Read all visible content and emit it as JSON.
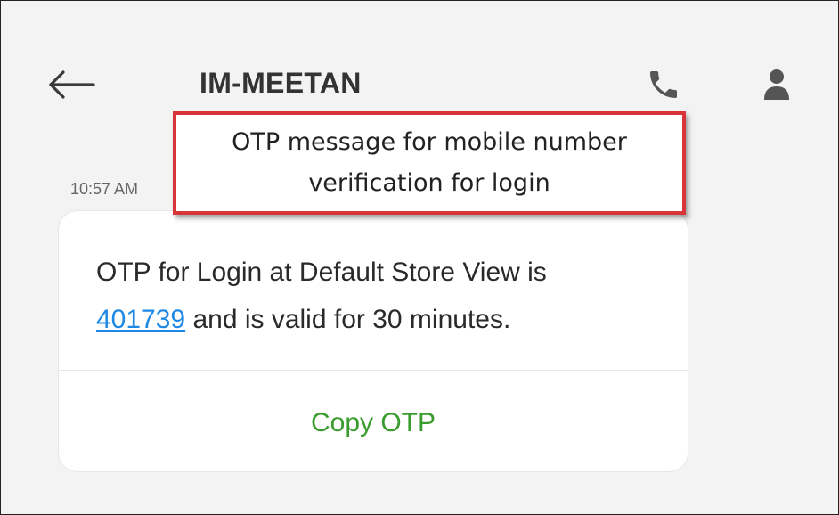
{
  "header": {
    "title": "IM-MEETAN",
    "back_icon": "arrow-left-icon",
    "call_icon": "phone-icon",
    "contact_icon": "person-icon"
  },
  "annotation": {
    "line1": "OTP message for mobile number",
    "line2": "verification for login",
    "border_color": "#d9343a"
  },
  "message": {
    "timestamp": "10:57 AM",
    "text_before_otp": "OTP for Login at Default Store View is",
    "otp": "401739",
    "text_after_otp": " and is valid for 30 minutes.",
    "action_label": "Copy OTP"
  },
  "colors": {
    "link": "#1e88e5",
    "action": "#3a9b2e",
    "background": "#f3f3f3"
  }
}
